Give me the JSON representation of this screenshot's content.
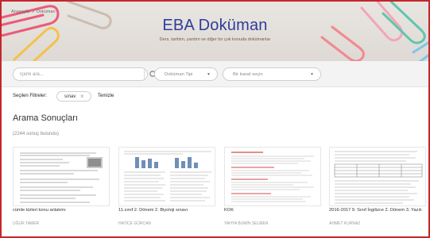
{
  "breadcrumb": {
    "home": "Anasayfa",
    "separator": "»",
    "current": "Doküman"
  },
  "hero": {
    "title": "EBA Doküman",
    "subtitle": "Ders, tarihim, yardım ve diğer bir çok konuda dokümanlar"
  },
  "search": {
    "placeholder": "İçerik ara...",
    "button_icon": "search-icon"
  },
  "doc_type_select": {
    "selected": "Doküman Tipi"
  },
  "channel_select": {
    "selected": "Bir kanal seçin"
  },
  "filters": {
    "label": "Seçilen Filtreler:",
    "chips": [
      {
        "label": "sınav",
        "remove": "×"
      }
    ],
    "clear_label": "Temizle"
  },
  "results": {
    "title": "Arama Sonuçları",
    "count": "(2244 sonuç bulundu)",
    "items": [
      {
        "title": "cümle türleri konu anlatımı",
        "author": "UĞUR TAMER"
      },
      {
        "title": "11.sınıf 2. Dönem 2. Biyoloji sınavı",
        "author": "HATİCE GÜRCAN"
      },
      {
        "title": "KOK",
        "author": "YAHYA BUMİN SELMEN"
      },
      {
        "title": "2016-2017 9. Sınıf İngilizce 2. Dönem 3. Yazılı",
        "author": "AHMET KURNAZ"
      }
    ]
  },
  "colors": {
    "brand_blue": "#2e3d9b",
    "frame_red": "#c4262b"
  }
}
